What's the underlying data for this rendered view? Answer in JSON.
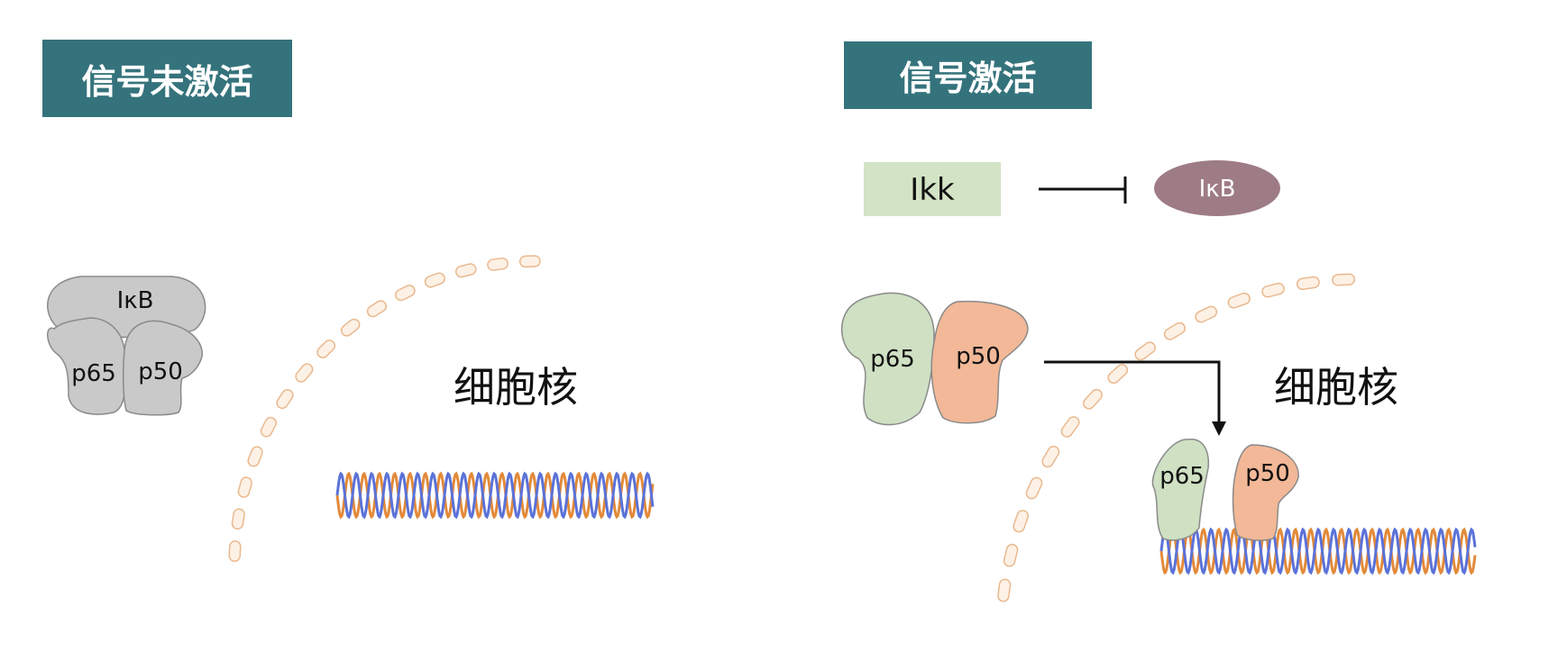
{
  "panels": {
    "inactive": {
      "title": "信号未激活",
      "complex": {
        "ikb": "IκB",
        "p65": "p65",
        "p50": "p50"
      },
      "nucleus_label": "细胞核"
    },
    "active": {
      "title": "信号激活",
      "ikk_label": "Ikk",
      "ikb_label": "IκB",
      "cyto_dimer": {
        "p65": "p65",
        "p50": "p50"
      },
      "bound_dimer": {
        "p65": "p65",
        "p50": "p50"
      },
      "nucleus_label": "细胞核"
    }
  },
  "colors": {
    "header_bg": "#35737c",
    "inactive_protein": "#c9c9c9",
    "p65": "#cfe0c3",
    "p50": "#f2b897",
    "ikk_box": "#d3e3c5",
    "ikb_ellipse": "#9e7c85",
    "membrane_fill": "#fdf1e6",
    "membrane_stroke": "#eab98f",
    "dna_strand_a": "#5b72d8",
    "dna_strand_b": "#e38a3a"
  }
}
